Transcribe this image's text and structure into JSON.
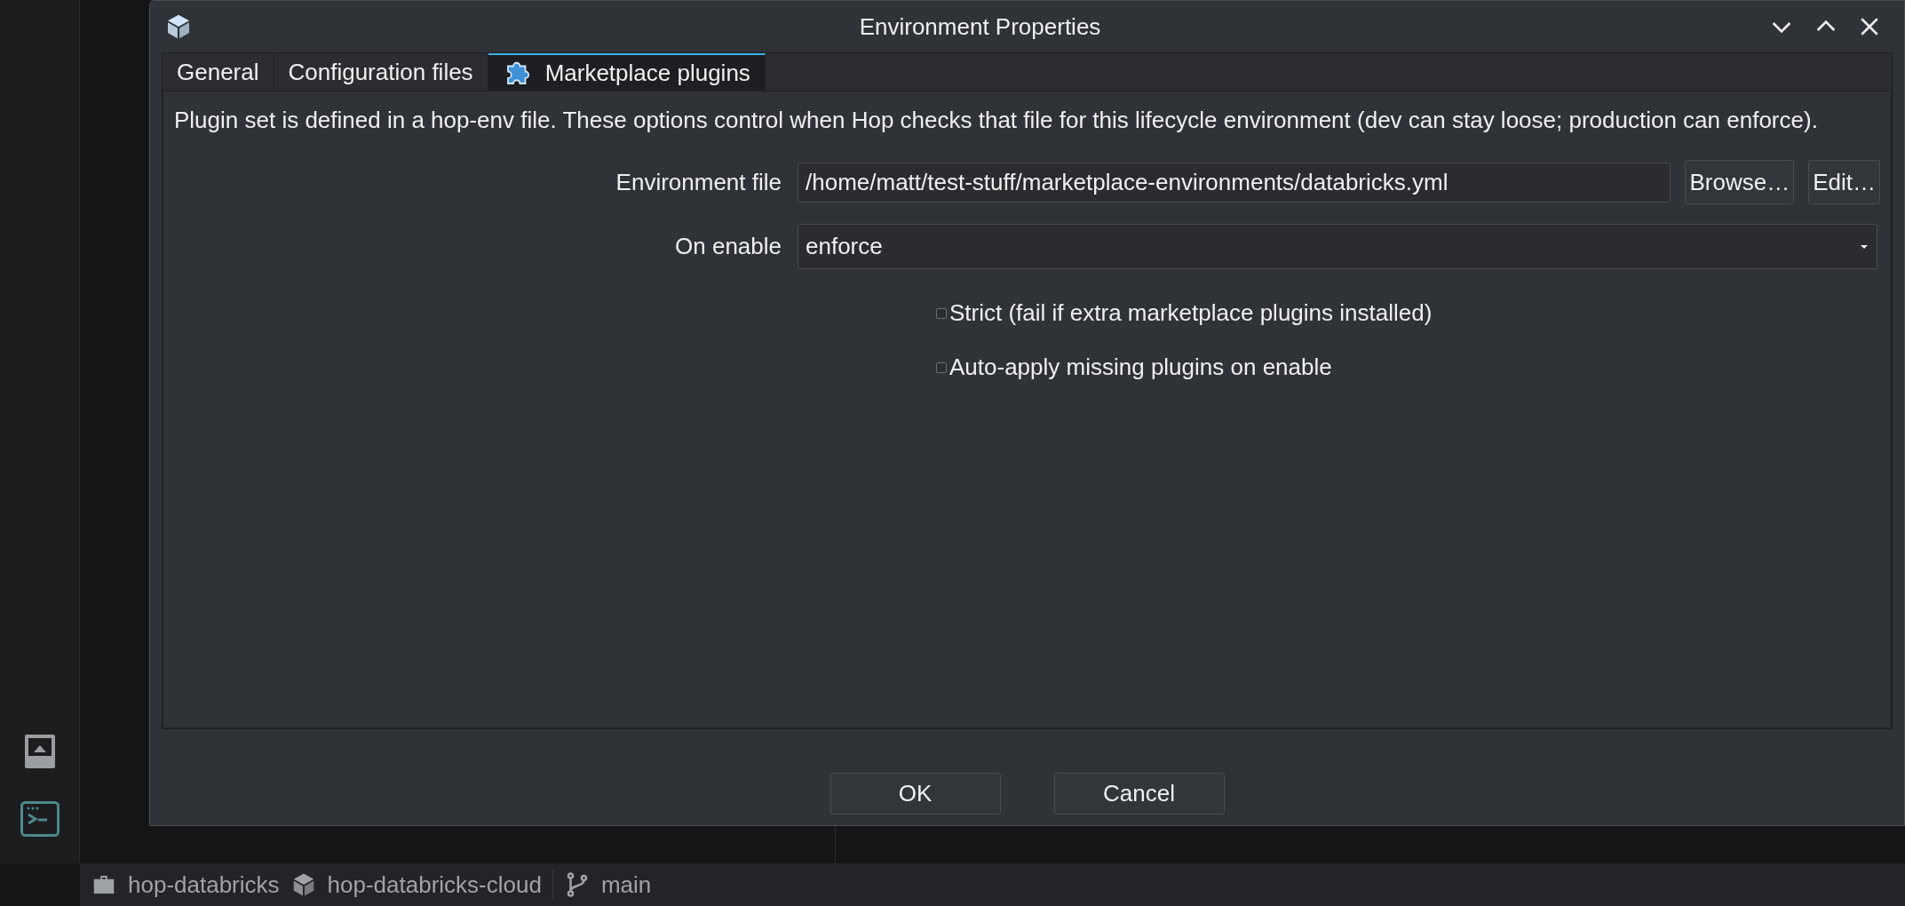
{
  "window": {
    "title": "Environment Properties"
  },
  "tabs": [
    {
      "label": "General",
      "selected": false,
      "kind": "text"
    },
    {
      "label": "Configuration files",
      "selected": false,
      "kind": "text"
    },
    {
      "label": "Marketplace plugins",
      "selected": true,
      "kind": "puzzle"
    }
  ],
  "description": "Plugin set is defined in a hop-env file. These options control when Hop checks that file for this lifecycle environment (dev can stay loose; production can enforce).",
  "environment_file": {
    "label": "Environment file",
    "value": "/home/matt/test-stuff/marketplace-environments/databricks.yml",
    "buttons": [
      "Browse…",
      "Edit…"
    ]
  },
  "on_enable": {
    "label": "On enable",
    "value": "enforce"
  },
  "options": [
    {
      "label": "Strict (fail if extra marketplace plugins installed)",
      "checked": false
    },
    {
      "label": "Auto-apply missing plugins on enable",
      "checked": false
    }
  ],
  "buttons": [
    "OK",
    "Cancel"
  ],
  "status_bar": {
    "project": "hop-databricks",
    "environment": "hop-databricks-cloud",
    "branch": "main"
  }
}
